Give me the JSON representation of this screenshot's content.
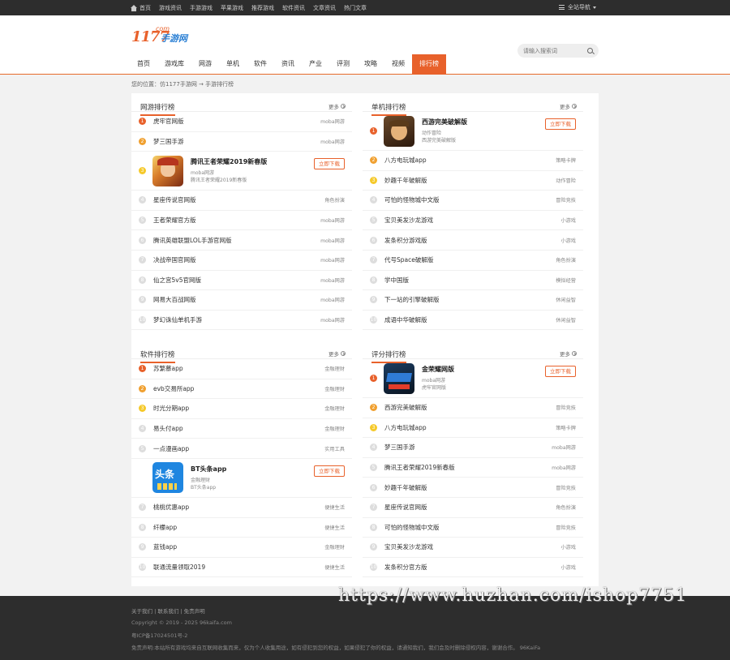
{
  "topbar": {
    "links": [
      "首页",
      "游戏资讯",
      "手游游戏",
      "苹果游戏",
      "推荐游戏",
      "软件资讯",
      "文章资讯",
      "热门文章"
    ],
    "site_nav": "全站导航"
  },
  "header": {
    "logo_num": "1177",
    "logo_com": "com",
    "logo_cn": "手游网",
    "search_placeholder": "请输入搜索词"
  },
  "nav": [
    "首页",
    "游戏库",
    "网游",
    "单机",
    "软件",
    "资讯",
    "产业",
    "评测",
    "攻略",
    "视频",
    "排行榜"
  ],
  "breadcrumb": "您的位置：仿1177手游网 → 手游排行榜",
  "more_label": "更多",
  "download_label": "立即下载",
  "sections": {
    "online": {
      "title": "网游排行榜",
      "rows": [
        {
          "rank": "1",
          "name": "虎牢官网版",
          "cat": "moba网游"
        },
        {
          "rank": "2",
          "name": "梦三国手游",
          "cat": "moba网游"
        }
      ],
      "featured": {
        "rank": "3",
        "name": "腾讯王者荣耀2019新春版",
        "line1": "moba网游",
        "line2": "腾讯王者荣耀2019新春版"
      },
      "rows2": [
        {
          "rank": "4",
          "name": "星座传说官网版",
          "cat": "角色扮演"
        },
        {
          "rank": "5",
          "name": "王者荣耀官方版",
          "cat": "moba网游"
        },
        {
          "rank": "6",
          "name": "腾讯英雄联盟LOL手游官网版",
          "cat": "moba网游"
        },
        {
          "rank": "7",
          "name": "决战帝国官网版",
          "cat": "moba网游"
        },
        {
          "rank": "8",
          "name": "仙之宫5v5官网版",
          "cat": "moba网游"
        },
        {
          "rank": "9",
          "name": "网易大百战网版",
          "cat": "moba网游"
        },
        {
          "rank": "10",
          "name": "梦幻诛仙单机手游",
          "cat": "moba网游"
        }
      ]
    },
    "single": {
      "title": "单机排行榜",
      "featured": {
        "rank": "1",
        "name": "西游完美破解版",
        "line1": "动作冒险",
        "line2": "西游完美破解版"
      },
      "rows": [
        {
          "rank": "2",
          "name": "八方电玩城app",
          "cat": "策略卡牌"
        },
        {
          "rank": "3",
          "name": "妙趣千年破解版",
          "cat": "动作冒险"
        },
        {
          "rank": "4",
          "name": "可怕的怪物城中文版",
          "cat": "冒险竞技"
        },
        {
          "rank": "5",
          "name": "宝贝美发沙龙游戏",
          "cat": "小游戏"
        },
        {
          "rank": "6",
          "name": "发条积分游戏版",
          "cat": "小游戏"
        },
        {
          "rank": "7",
          "name": "代号Space破解版",
          "cat": "角色扮演"
        },
        {
          "rank": "8",
          "name": "学中国版",
          "cat": "模拟经营"
        },
        {
          "rank": "9",
          "name": "下一站的引擎破解版",
          "cat": "休闲益智"
        },
        {
          "rank": "10",
          "name": "成语中华破解版",
          "cat": "休闲益智"
        }
      ]
    },
    "software": {
      "title": "软件排行榜",
      "rows": [
        {
          "rank": "1",
          "name": "苏繁慕app",
          "cat": "金融理财"
        },
        {
          "rank": "2",
          "name": "evb交易所app",
          "cat": "金融理财"
        },
        {
          "rank": "3",
          "name": "时光分期app",
          "cat": "金融理财"
        },
        {
          "rank": "4",
          "name": "易头付app",
          "cat": "金融理财"
        },
        {
          "rank": "5",
          "name": "一点漫画app",
          "cat": "实用工具"
        }
      ],
      "featured": {
        "rank": "6",
        "name": "BT头条app",
        "line1": "金融理财",
        "line2": "BT头条app"
      },
      "rows2": [
        {
          "rank": "7",
          "name": "桃桃优惠app",
          "cat": "便捷生活"
        },
        {
          "rank": "8",
          "name": "纤檬app",
          "cat": "便捷生活"
        },
        {
          "rank": "9",
          "name": "蓝钱app",
          "cat": "金融理财"
        },
        {
          "rank": "10",
          "name": "联通流量领取2019",
          "cat": "便捷生活"
        }
      ]
    },
    "rating": {
      "title": "评分排行榜",
      "featured": {
        "rank": "1",
        "name": "金荣耀网版",
        "line1": "moba网游",
        "line2": "虎牢官网版"
      },
      "rows": [
        {
          "rank": "2",
          "name": "西游完美破解版",
          "cat": "冒险竞技"
        },
        {
          "rank": "3",
          "name": "八方电玩城app",
          "cat": "策略卡牌"
        },
        {
          "rank": "4",
          "name": "梦三国手游",
          "cat": "moba网游"
        },
        {
          "rank": "5",
          "name": "腾讯王者荣耀2019新春版",
          "cat": "moba网游"
        },
        {
          "rank": "6",
          "name": "妙趣千年破解版",
          "cat": "冒险竞技"
        },
        {
          "rank": "7",
          "name": "星座传说官网版",
          "cat": "角色扮演"
        },
        {
          "rank": "8",
          "name": "可怕的怪物城中文版",
          "cat": "冒险竞技"
        },
        {
          "rank": "9",
          "name": "宝贝美发沙龙游戏",
          "cat": "小游戏"
        },
        {
          "rank": "10",
          "name": "发条积分官方版",
          "cat": "小游戏"
        }
      ]
    }
  },
  "footer": {
    "links": "关于我们 | 联系我们 | 免责声明",
    "copyright": "Copyright © 2019 - 2025 96kaifa.com",
    "icp": "粤ICP备17024501号-2",
    "disclaimer": "免责声明:本站所有游戏均来自互联网收集而来，仅为个人收集用途，如有侵犯到您的权益，如果侵犯了你的权益，请通知我们，我们会及时删除侵权内容，谢谢合作。 96KaiFa"
  },
  "watermark": "https://www.huzhan.com/ishop7751"
}
